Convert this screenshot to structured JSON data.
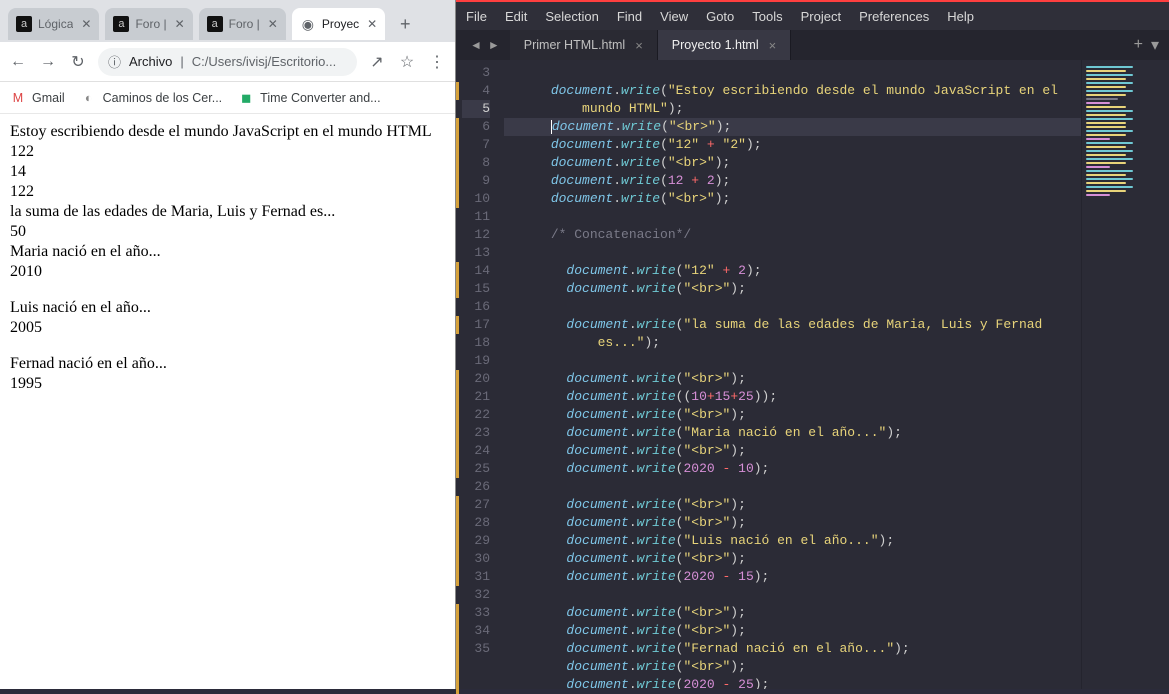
{
  "browser": {
    "tabs": [
      {
        "title": "Lógica"
      },
      {
        "title": "Foro |"
      },
      {
        "title": "Foro |"
      },
      {
        "title": "Proyec"
      }
    ],
    "nav": {
      "back": "←",
      "forward": "→",
      "reload": "↻",
      "info": "ⓘ",
      "archivo_label": "Archivo",
      "url": "C:/Users/ivisj/Escritorio...",
      "share": "↗",
      "star": "☆",
      "menu": "⋮"
    },
    "bookmarks": [
      {
        "icon": "M",
        "label": "Gmail",
        "color": "#d44"
      },
      {
        "icon": "◐",
        "label": "Caminos de los Cer...",
        "color": "#888"
      },
      {
        "icon": "◼",
        "label": "Time Converter and...",
        "color": "#2a6"
      }
    ],
    "page_lines": [
      "Estoy escribiendo desde el mundo JavaScript en el mundo HTML",
      "122",
      "14",
      "122",
      "la suma de las edades de Maria, Luis y Fernad es...",
      "50",
      "Maria nació en el año...",
      "2010",
      "",
      "Luis nació en el año...",
      "2005",
      "",
      "Fernad nació en el año...",
      "1995"
    ]
  },
  "editor": {
    "menus": [
      "File",
      "Edit",
      "Selection",
      "Find",
      "View",
      "Goto",
      "Tools",
      "Project",
      "Preferences",
      "Help"
    ],
    "tabs": [
      {
        "title": "Primer HTML.html",
        "active": false
      },
      {
        "title": "Proyecto 1.html",
        "active": true
      }
    ],
    "nav_prev": "◄",
    "nav_next": "►",
    "plus": "+",
    "dropdown": "▾",
    "code": [
      {
        "n": 3,
        "frag": []
      },
      {
        "n": 4,
        "frag": [
          [
            "i",
            "      "
          ],
          [
            "doc",
            "document"
          ],
          [
            "pn",
            "."
          ],
          [
            "fn",
            "write"
          ],
          [
            "pn",
            "("
          ],
          [
            "str",
            "\"Estoy escribiendo desde el mundo JavaScript en el "
          ]
        ]
      },
      {
        "n": "",
        "frag": [
          [
            "i",
            "          "
          ],
          [
            "str",
            "mundo HTML\""
          ],
          [
            "pn",
            ");"
          ]
        ]
      },
      {
        "n": 5,
        "cur": true,
        "frag": [
          [
            "i",
            "      "
          ],
          [
            "caret",
            ""
          ],
          [
            "doc",
            "document"
          ],
          [
            "pn",
            "."
          ],
          [
            "fn",
            "write"
          ],
          [
            "pn",
            "("
          ],
          [
            "str",
            "\"<br>\""
          ],
          [
            "pn",
            ");"
          ]
        ]
      },
      {
        "n": 6,
        "frag": [
          [
            "i",
            "      "
          ],
          [
            "doc",
            "document"
          ],
          [
            "pn",
            "."
          ],
          [
            "fn",
            "write"
          ],
          [
            "pn",
            "("
          ],
          [
            "str",
            "\"12\""
          ],
          [
            "pn",
            " "
          ],
          [
            "op",
            "+"
          ],
          [
            "pn",
            " "
          ],
          [
            "str",
            "\"2\""
          ],
          [
            "pn",
            ");"
          ]
        ]
      },
      {
        "n": 7,
        "frag": [
          [
            "i",
            "      "
          ],
          [
            "doc",
            "document"
          ],
          [
            "pn",
            "."
          ],
          [
            "fn",
            "write"
          ],
          [
            "pn",
            "("
          ],
          [
            "str",
            "\"<br>\""
          ],
          [
            "pn",
            ");"
          ]
        ]
      },
      {
        "n": 8,
        "frag": [
          [
            "i",
            "      "
          ],
          [
            "doc",
            "document"
          ],
          [
            "pn",
            "."
          ],
          [
            "fn",
            "write"
          ],
          [
            "pn",
            "("
          ],
          [
            "num",
            "12"
          ],
          [
            "pn",
            " "
          ],
          [
            "op",
            "+"
          ],
          [
            "pn",
            " "
          ],
          [
            "num",
            "2"
          ],
          [
            "pn",
            ");"
          ]
        ]
      },
      {
        "n": 9,
        "frag": [
          [
            "i",
            "      "
          ],
          [
            "doc",
            "document"
          ],
          [
            "pn",
            "."
          ],
          [
            "fn",
            "write"
          ],
          [
            "pn",
            "("
          ],
          [
            "str",
            "\"<br>\""
          ],
          [
            "pn",
            ");"
          ]
        ]
      },
      {
        "n": 10,
        "frag": []
      },
      {
        "n": 11,
        "frag": [
          [
            "i",
            "      "
          ],
          [
            "cm",
            "/* Concatenacion*/"
          ]
        ]
      },
      {
        "n": 12,
        "frag": []
      },
      {
        "n": 13,
        "frag": [
          [
            "i",
            "        "
          ],
          [
            "doc",
            "document"
          ],
          [
            "pn",
            "."
          ],
          [
            "fn",
            "write"
          ],
          [
            "pn",
            "("
          ],
          [
            "str",
            "\"12\""
          ],
          [
            "pn",
            " "
          ],
          [
            "op",
            "+"
          ],
          [
            "pn",
            " "
          ],
          [
            "num",
            "2"
          ],
          [
            "pn",
            ");"
          ]
        ]
      },
      {
        "n": 14,
        "frag": [
          [
            "i",
            "        "
          ],
          [
            "doc",
            "document"
          ],
          [
            "pn",
            "."
          ],
          [
            "fn",
            "write"
          ],
          [
            "pn",
            "("
          ],
          [
            "str",
            "\"<br>\""
          ],
          [
            "pn",
            ");"
          ]
        ]
      },
      {
        "n": 15,
        "frag": []
      },
      {
        "n": 16,
        "frag": [
          [
            "i",
            "        "
          ],
          [
            "doc",
            "document"
          ],
          [
            "pn",
            "."
          ],
          [
            "fn",
            "write"
          ],
          [
            "pn",
            "("
          ],
          [
            "str",
            "\"la suma de las edades de Maria, Luis y Fernad "
          ]
        ]
      },
      {
        "n": "",
        "frag": [
          [
            "i",
            "            "
          ],
          [
            "str",
            "es...\""
          ],
          [
            "pn",
            ");"
          ]
        ]
      },
      {
        "n": 17,
        "frag": []
      },
      {
        "n": 18,
        "frag": [
          [
            "i",
            "        "
          ],
          [
            "doc",
            "document"
          ],
          [
            "pn",
            "."
          ],
          [
            "fn",
            "write"
          ],
          [
            "pn",
            "("
          ],
          [
            "str",
            "\"<br>\""
          ],
          [
            "pn",
            ");"
          ]
        ]
      },
      {
        "n": 19,
        "frag": [
          [
            "i",
            "        "
          ],
          [
            "doc",
            "document"
          ],
          [
            "pn",
            "."
          ],
          [
            "fn",
            "write"
          ],
          [
            "pn",
            "(("
          ],
          [
            "num",
            "10"
          ],
          [
            "op",
            "+"
          ],
          [
            "num",
            "15"
          ],
          [
            "op",
            "+"
          ],
          [
            "num",
            "25"
          ],
          [
            "pn",
            "));"
          ]
        ]
      },
      {
        "n": 20,
        "frag": [
          [
            "i",
            "        "
          ],
          [
            "doc",
            "document"
          ],
          [
            "pn",
            "."
          ],
          [
            "fn",
            "write"
          ],
          [
            "pn",
            "("
          ],
          [
            "str",
            "\"<br>\""
          ],
          [
            "pn",
            ");"
          ]
        ]
      },
      {
        "n": 21,
        "frag": [
          [
            "i",
            "        "
          ],
          [
            "doc",
            "document"
          ],
          [
            "pn",
            "."
          ],
          [
            "fn",
            "write"
          ],
          [
            "pn",
            "("
          ],
          [
            "str",
            "\"Maria nació en el año...\""
          ],
          [
            "pn",
            ");"
          ]
        ]
      },
      {
        "n": 22,
        "frag": [
          [
            "i",
            "        "
          ],
          [
            "doc",
            "document"
          ],
          [
            "pn",
            "."
          ],
          [
            "fn",
            "write"
          ],
          [
            "pn",
            "("
          ],
          [
            "str",
            "\"<br>\""
          ],
          [
            "pn",
            ");"
          ]
        ]
      },
      {
        "n": 23,
        "frag": [
          [
            "i",
            "        "
          ],
          [
            "doc",
            "document"
          ],
          [
            "pn",
            "."
          ],
          [
            "fn",
            "write"
          ],
          [
            "pn",
            "("
          ],
          [
            "num",
            "2020"
          ],
          [
            "pn",
            " "
          ],
          [
            "op",
            "-"
          ],
          [
            "pn",
            " "
          ],
          [
            "num",
            "10"
          ],
          [
            "pn",
            ");"
          ]
        ]
      },
      {
        "n": 24,
        "frag": []
      },
      {
        "n": 25,
        "frag": [
          [
            "i",
            "        "
          ],
          [
            "doc",
            "document"
          ],
          [
            "pn",
            "."
          ],
          [
            "fn",
            "write"
          ],
          [
            "pn",
            "("
          ],
          [
            "str",
            "\"<br>\""
          ],
          [
            "pn",
            ");"
          ]
        ]
      },
      {
        "n": 26,
        "frag": [
          [
            "i",
            "        "
          ],
          [
            "doc",
            "document"
          ],
          [
            "pn",
            "."
          ],
          [
            "fn",
            "write"
          ],
          [
            "pn",
            "("
          ],
          [
            "str",
            "\"<br>\""
          ],
          [
            "pn",
            ");"
          ]
        ]
      },
      {
        "n": 27,
        "frag": [
          [
            "i",
            "        "
          ],
          [
            "doc",
            "document"
          ],
          [
            "pn",
            "."
          ],
          [
            "fn",
            "write"
          ],
          [
            "pn",
            "("
          ],
          [
            "str",
            "\"Luis nació en el año...\""
          ],
          [
            "pn",
            ");"
          ]
        ]
      },
      {
        "n": 28,
        "frag": [
          [
            "i",
            "        "
          ],
          [
            "doc",
            "document"
          ],
          [
            "pn",
            "."
          ],
          [
            "fn",
            "write"
          ],
          [
            "pn",
            "("
          ],
          [
            "str",
            "\"<br>\""
          ],
          [
            "pn",
            ");"
          ]
        ]
      },
      {
        "n": 29,
        "frag": [
          [
            "i",
            "        "
          ],
          [
            "doc",
            "document"
          ],
          [
            "pn",
            "."
          ],
          [
            "fn",
            "write"
          ],
          [
            "pn",
            "("
          ],
          [
            "num",
            "2020"
          ],
          [
            "pn",
            " "
          ],
          [
            "op",
            "-"
          ],
          [
            "pn",
            " "
          ],
          [
            "num",
            "15"
          ],
          [
            "pn",
            ");"
          ]
        ]
      },
      {
        "n": 30,
        "frag": []
      },
      {
        "n": 31,
        "frag": [
          [
            "i",
            "        "
          ],
          [
            "doc",
            "document"
          ],
          [
            "pn",
            "."
          ],
          [
            "fn",
            "write"
          ],
          [
            "pn",
            "("
          ],
          [
            "str",
            "\"<br>\""
          ],
          [
            "pn",
            ");"
          ]
        ]
      },
      {
        "n": 32,
        "frag": [
          [
            "i",
            "        "
          ],
          [
            "doc",
            "document"
          ],
          [
            "pn",
            "."
          ],
          [
            "fn",
            "write"
          ],
          [
            "pn",
            "("
          ],
          [
            "str",
            "\"<br>\""
          ],
          [
            "pn",
            ");"
          ]
        ]
      },
      {
        "n": 33,
        "frag": [
          [
            "i",
            "        "
          ],
          [
            "doc",
            "document"
          ],
          [
            "pn",
            "."
          ],
          [
            "fn",
            "write"
          ],
          [
            "pn",
            "("
          ],
          [
            "str",
            "\"Fernad nació en el año...\""
          ],
          [
            "pn",
            ");"
          ]
        ]
      },
      {
        "n": 34,
        "frag": [
          [
            "i",
            "        "
          ],
          [
            "doc",
            "document"
          ],
          [
            "pn",
            "."
          ],
          [
            "fn",
            "write"
          ],
          [
            "pn",
            "("
          ],
          [
            "str",
            "\"<br>\""
          ],
          [
            "pn",
            ");"
          ]
        ]
      },
      {
        "n": 35,
        "frag": [
          [
            "i",
            "        "
          ],
          [
            "doc",
            "document"
          ],
          [
            "pn",
            "."
          ],
          [
            "fn",
            "write"
          ],
          [
            "pn",
            "("
          ],
          [
            "num",
            "2020"
          ],
          [
            "pn",
            " "
          ],
          [
            "op",
            "-"
          ],
          [
            "pn",
            " "
          ],
          [
            "num",
            "25"
          ],
          [
            "pn",
            ");"
          ]
        ]
      }
    ],
    "modified_lines": [
      4,
      5,
      6,
      7,
      8,
      9,
      13,
      14,
      16,
      18,
      19,
      20,
      21,
      22,
      23,
      25,
      26,
      27,
      28,
      29,
      31,
      32,
      33,
      34,
      35
    ]
  }
}
